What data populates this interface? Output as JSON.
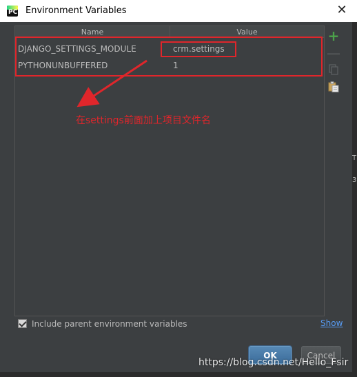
{
  "window": {
    "title": "Environment Variables",
    "close_glyph": "✕",
    "app_icon_text": "PC"
  },
  "table": {
    "headers": [
      "Name",
      "Value"
    ],
    "rows": [
      {
        "name": "DJANGO_SETTINGS_MODULE",
        "value": "crm.settings"
      },
      {
        "name": "PYTHONUNBUFFERED",
        "value": "1"
      }
    ]
  },
  "toolbar": {
    "add_glyph": "+",
    "remove_glyph": "—"
  },
  "annotation": {
    "text": "在settings前面加上项目文件名",
    "color": "#e0262b"
  },
  "options": {
    "include_parent_label": "Include parent environment variables",
    "include_parent_checked": true,
    "show_link": "Show"
  },
  "buttons": {
    "ok": "OK",
    "cancel": "Cancel"
  },
  "watermark": "https://blog.csdn.net/Hello_Fsir",
  "background_strip": {
    "text_top": "T",
    "text_bottom": "3."
  },
  "colors": {
    "background": "#3c3f41",
    "text": "#bbbbbb",
    "add": "#4ca34a",
    "link": "#589df6",
    "ok_button": "#4a7fb0"
  }
}
